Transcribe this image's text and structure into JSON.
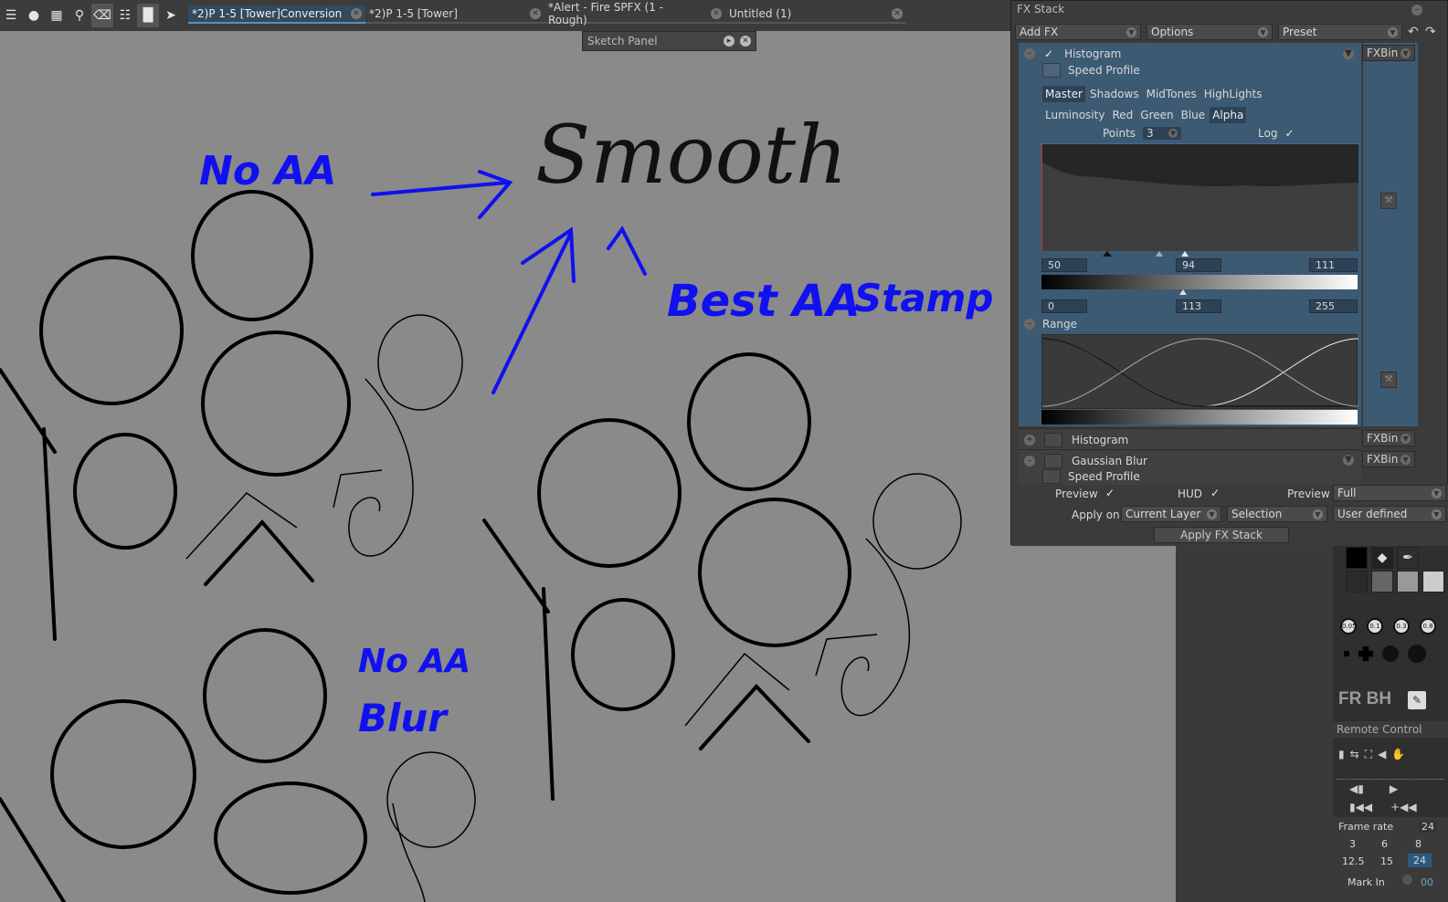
{
  "tabs": [
    {
      "label": "*2)P 1-5 [Tower]Conversion",
      "active": true
    },
    {
      "label": "*2)P 1-5 [Tower]",
      "active": false
    },
    {
      "label": "*Alert - Fire SPFX (1 - Rough)",
      "active": false
    },
    {
      "label": "Untitled (1)",
      "active": false
    }
  ],
  "toolbar_icons": [
    "layers-icon",
    "bulb-icon",
    "remote-icon",
    "search-icon",
    "brush-holder-icon",
    "library-icon",
    "chart-icon",
    "paper-plane-icon"
  ],
  "sketch_panel": {
    "title": "Sketch Panel"
  },
  "canvas": {
    "smooth_label": "Smooth",
    "annotations": {
      "no_aa": "No AA",
      "best_aa": "Best AA",
      "stamp": "Stamp",
      "no_aa_2": "No AA",
      "blur": "Blur"
    }
  },
  "fx_stack": {
    "title": "FX Stack",
    "add_fx": "Add FX",
    "options": "Options",
    "preset": "Preset",
    "histogram": {
      "name": "Histogram",
      "speed_profile": "Speed Profile",
      "fxbin": "FXBin",
      "channel_tabs_1": [
        "Master",
        "Shadows",
        "MidTones",
        "HighLights"
      ],
      "channel_tabs_2": [
        "Luminosity",
        "Red",
        "Green",
        "Blue",
        "Alpha"
      ],
      "active_tab_1": "Master",
      "active_tab_2": "Alpha",
      "points_label": "Points",
      "points_value": "3",
      "log_label": "Log",
      "input_low": "50",
      "input_mid": "94",
      "input_high": "111",
      "output_low": "0",
      "output_mid": "113",
      "output_high": "255",
      "range_label": "Range"
    },
    "histogram_2": {
      "name": "Histogram",
      "fxbin": "FXBin"
    },
    "gaussian_blur": {
      "name": "Gaussian Blur",
      "speed_profile": "Speed Profile",
      "fxbin": "FXBin"
    },
    "footer": {
      "preview_label": "Preview",
      "hud_label": "HUD",
      "preview2_label": "Preview",
      "preview2_value": "Full",
      "apply_on_label": "Apply on",
      "apply_on_value": "Current Layer",
      "selection_value": "Selection",
      "user_defined_value": "User defined",
      "apply_button": "Apply FX Stack"
    }
  },
  "brush_sizes": [
    "0.05",
    "0.1",
    "0.3",
    "0.8"
  ],
  "fr_bh": "FR BH",
  "remote_control": {
    "title": "Remote Control",
    "frame_rate_label": "Frame rate",
    "frame_rate_value": "24",
    "rates_row1": [
      "3",
      "6",
      "8"
    ],
    "rates_row2": [
      "12.5",
      "15",
      "24"
    ],
    "mark_in_label": "Mark In",
    "mark_in_value": "00"
  },
  "colors": {
    "canvas_bg": "#8a8a8a",
    "annotation_blue": "#1010f0",
    "panel_bg": "#3b3b3b",
    "fx_section_bg": "#3d5a73",
    "tab_active": "#334a5c"
  }
}
